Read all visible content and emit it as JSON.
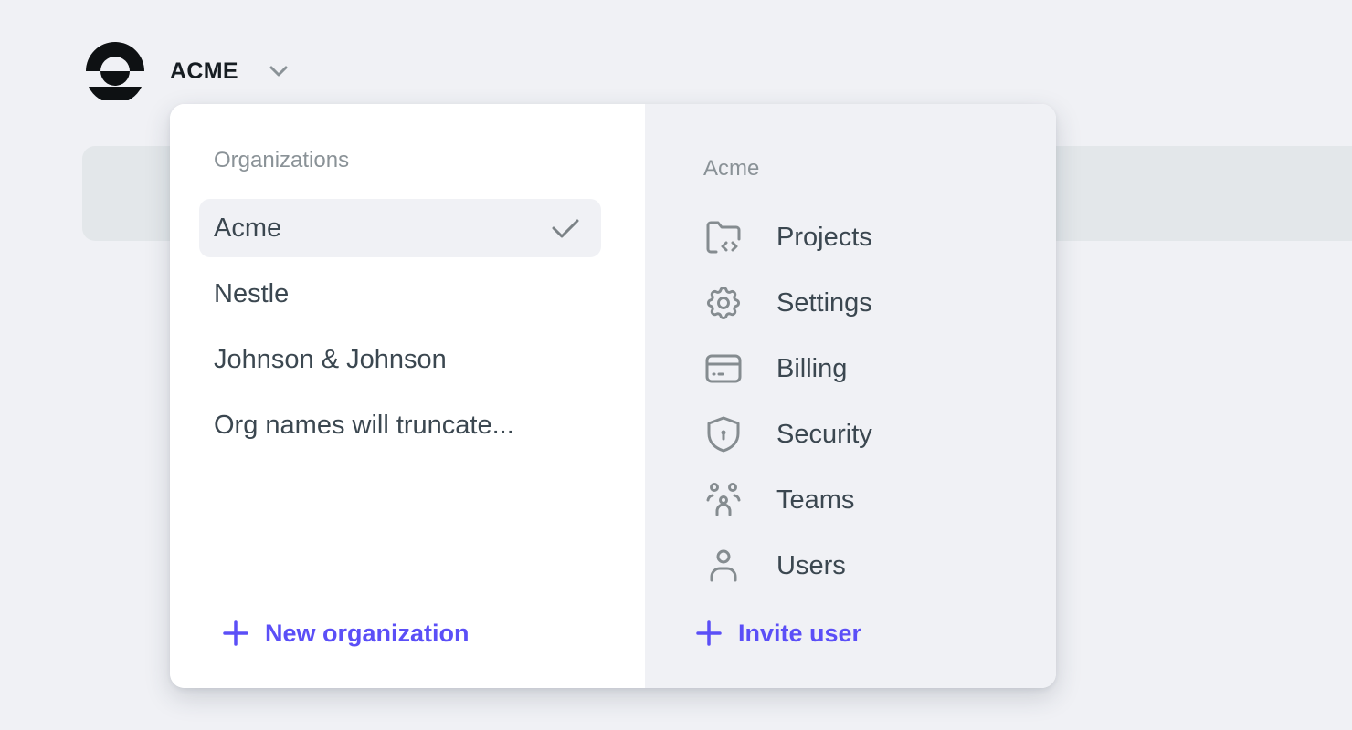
{
  "header": {
    "logo_icon": "acme-logo",
    "org_name": "ACME",
    "switcher_icon": "chevron-down-icon"
  },
  "dropdown": {
    "organizations": {
      "heading": "Organizations",
      "items": [
        {
          "label": "Acme",
          "selected": true
        },
        {
          "label": "Nestle",
          "selected": false
        },
        {
          "label": "Johnson & Johnson",
          "selected": false
        },
        {
          "label": "Org names will truncate...",
          "selected": false
        }
      ],
      "new_label": "New organization"
    },
    "org_menu": {
      "heading": "Acme",
      "items": [
        {
          "label": "Projects",
          "icon": "folder-code-icon"
        },
        {
          "label": "Settings",
          "icon": "gear-icon"
        },
        {
          "label": "Billing",
          "icon": "credit-card-icon"
        },
        {
          "label": "Security",
          "icon": "shield-lock-icon"
        },
        {
          "label": "Teams",
          "icon": "team-icon"
        },
        {
          "label": "Users",
          "icon": "user-icon"
        }
      ],
      "invite_label": "Invite user"
    }
  },
  "colors": {
    "accent": "#5b4ff7",
    "background": "#f0f1f5",
    "text": "#3b4750",
    "muted": "#8a9297",
    "icon": "#858c90"
  }
}
